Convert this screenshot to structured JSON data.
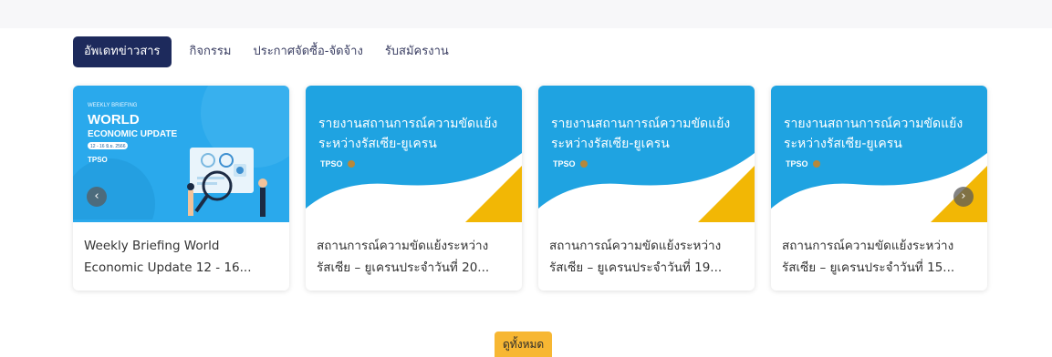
{
  "tabs": [
    {
      "label": "อัพเดทข่าวสาร",
      "active": true
    },
    {
      "label": "กิจกรรม",
      "active": false
    },
    {
      "label": "ประกาศจัดซื้อ-จัดจ้าง",
      "active": false
    },
    {
      "label": "รับสมัครงาน",
      "active": false
    }
  ],
  "cards": [
    {
      "thumb": {
        "small": "WEEKLY BRIEFING",
        "big1": "WORLD",
        "big2": "ECONOMIC UPDATE",
        "date": "12 - 16 มิ.ย. 2566",
        "logo": "TPSO"
      },
      "caption_line1": "Weekly Briefing World",
      "caption_line2": "Economic Update 12 - 16..."
    },
    {
      "thumb": {
        "title1": "รายงานสถานการณ์ความขัดแย้ง",
        "title2": "ระหว่างรัสเซีย-ยูเครน",
        "logo": "TPSO"
      },
      "caption_line1": "สถานการณ์ความขัดแย้งระหว่าง",
      "caption_line2": "รัสเซีย – ยูเครนประจำวันที่ 20..."
    },
    {
      "thumb": {
        "title1": "รายงานสถานการณ์ความขัดแย้ง",
        "title2": "ระหว่างรัสเซีย-ยูเครน",
        "logo": "TPSO"
      },
      "caption_line1": "สถานการณ์ความขัดแย้งระหว่าง",
      "caption_line2": "รัสเซีย – ยูเครนประจำวันที่ 19..."
    },
    {
      "thumb": {
        "title1": "รายงานสถานการณ์ความขัดแย้ง",
        "title2": "ระหว่างรัสเซีย-ยูเครน",
        "logo": "TPSO"
      },
      "caption_line1": "สถานการณ์ความขัดแย้งระหว่าง",
      "caption_line2": "รัสเซีย – ยูเครนประจำวันที่ 15..."
    }
  ],
  "nav": {
    "prev_icon": "chevron-left-icon",
    "next_icon": "chevron-right-icon",
    "prev_glyph": "‹",
    "next_glyph": "›"
  },
  "view_all_label": "ดูทั้งหมด",
  "colors": {
    "tab_active_bg": "#1d2a5c",
    "thumb_blue": "#1fa3e1",
    "thumb_yellow": "#f2b705",
    "view_all_bg": "#f7b733"
  }
}
